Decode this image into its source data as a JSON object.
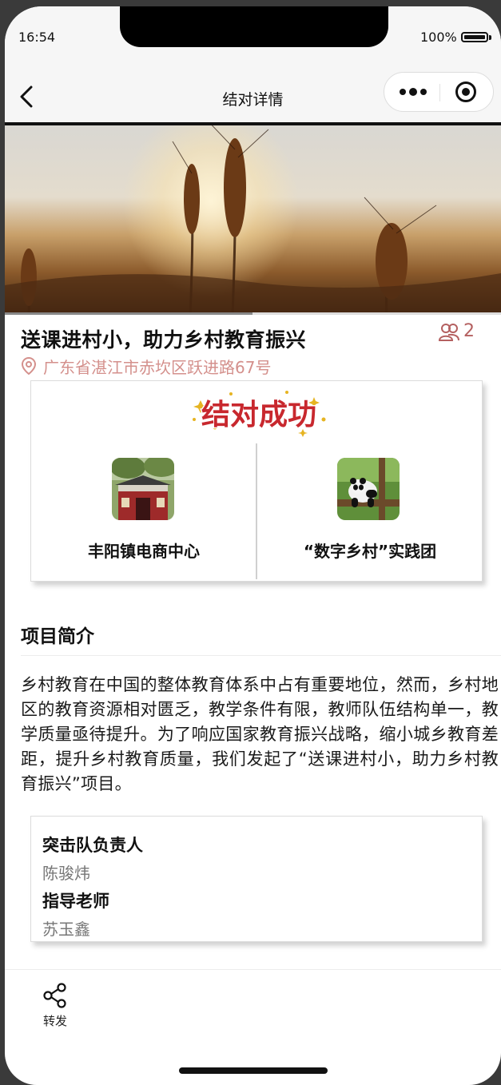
{
  "status_bar": {
    "time": "16:54",
    "battery_percent": "100%"
  },
  "nav": {
    "title": "结对详情",
    "back_icon": "chevron-left-icon",
    "more_icon": "more-dots-icon",
    "close_icon": "target-circle-icon"
  },
  "hero": {
    "image": "wheat-field-sunset"
  },
  "project": {
    "title": "送课进村小，助力乡村教育振兴",
    "member_count": "2",
    "member_icon": "people-icon",
    "address_icon": "location-pin-icon",
    "address": "广东省湛江市赤坎区跃进路67号"
  },
  "pairing": {
    "badge_text": "结对成功",
    "left": {
      "name": "丰阳镇电商中心",
      "image": "building-photo"
    },
    "right": {
      "name": "“数字乡村”实践团",
      "image": "panda-photo"
    }
  },
  "intro": {
    "heading": "项目简介",
    "body": "乡村教育在中国的整体教育体系中占有重要地位，然而，乡村地区的教育资源相对匮乏，教学条件有限，教师队伍结构单一，教学质量亟待提升。为了响应国家教育振兴战略，缩小城乡教育差距，提升乡村教育质量，我们发起了“送课进村小，助力乡村教育振兴”项目。"
  },
  "people": {
    "leader_role": "突击队负责人",
    "leader_name": "陈骏炜",
    "teacher_role": "指导老师",
    "teacher_name": "苏玉鑫"
  },
  "footer": {
    "share_label": "转发",
    "share_icon": "share-icon"
  },
  "colors": {
    "accent": "#b46060",
    "address": "#d4908c",
    "badge_red": "#c8282e",
    "badge_gold": "#e6b422"
  }
}
